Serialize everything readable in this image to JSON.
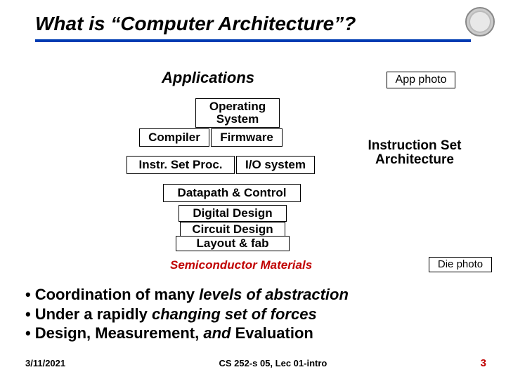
{
  "title": "What is “Computer Architecture”?",
  "diagram": {
    "applications": "Applications",
    "app_photo": "App photo",
    "os": "Operating System",
    "compiler": "Compiler",
    "firmware": "Firmware",
    "isp": "Instr. Set Proc.",
    "io": "I/O system",
    "dpc": "Datapath & Control",
    "dd": "Digital Design",
    "cd": "Circuit Design",
    "lf": "Layout & fab",
    "isa": "Instruction Set Architecture",
    "semi": "Semiconductor Materials",
    "die_photo": "Die photo"
  },
  "bullets": {
    "b1a": "Coordination of many ",
    "b1b": "levels of abstraction",
    "b2a": "Under a rapidly ",
    "b2b": "changing set of forces",
    "b3a": "Design, Measurement, ",
    "b3b": "and   ",
    "b3c": "Evaluation"
  },
  "footer": {
    "date": "3/11/2021",
    "course": "CS 252-s 05, Lec 01-intro",
    "page": "3"
  }
}
